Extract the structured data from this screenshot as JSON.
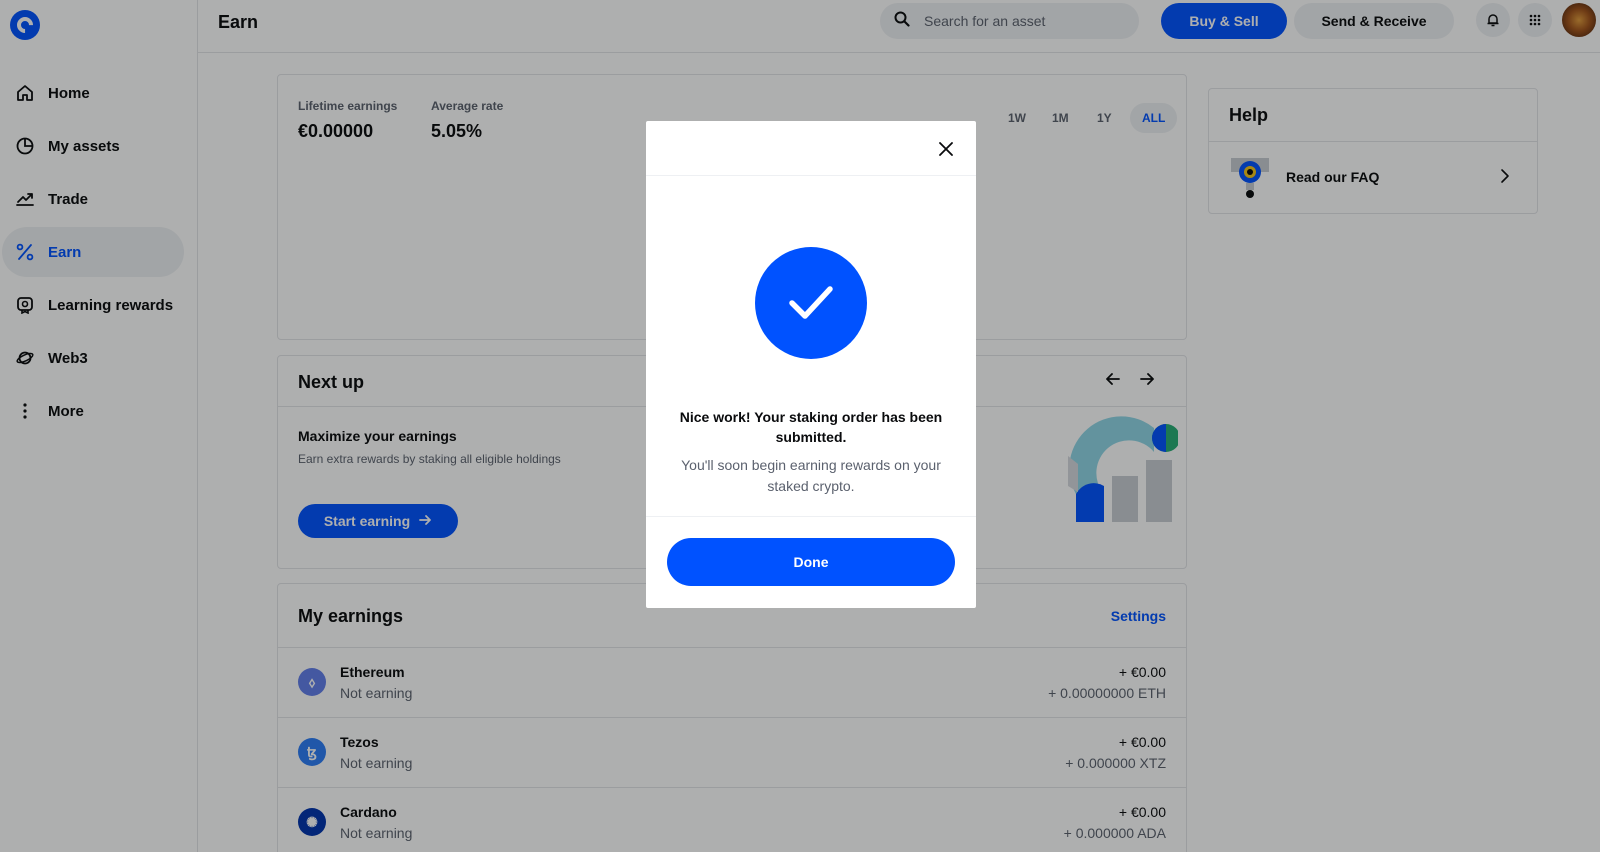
{
  "sidebar": {
    "items": [
      {
        "label": "Home",
        "icon": "home-icon"
      },
      {
        "label": "My assets",
        "icon": "pie-chart-icon"
      },
      {
        "label": "Trade",
        "icon": "trend-icon"
      },
      {
        "label": "Earn",
        "icon": "percent-icon",
        "active": true
      },
      {
        "label": "Learning rewards",
        "icon": "reward-icon"
      },
      {
        "label": "Web3",
        "icon": "planet-icon"
      },
      {
        "label": "More",
        "icon": "more-vertical-icon"
      }
    ]
  },
  "header": {
    "title": "Earn",
    "search_placeholder": "Search for an asset",
    "buy_sell_label": "Buy & Sell",
    "send_receive_label": "Send & Receive"
  },
  "summary": {
    "lifetime_label": "Lifetime earnings",
    "lifetime_value": "€0.00000",
    "rate_label": "Average rate",
    "rate_value": "5.05%",
    "ranges": [
      "1W",
      "1M",
      "1Y",
      "ALL"
    ],
    "selected_range": "ALL"
  },
  "next_up": {
    "title": "Next up",
    "heading": "Maximize your earnings",
    "description": "Earn extra rewards by staking all eligible holdings",
    "cta_label": "Start earning"
  },
  "my_earnings": {
    "title": "My earnings",
    "settings_label": "Settings",
    "rows": [
      {
        "name": "Ethereum",
        "status": "Not earning",
        "fiat": "+ €0.00",
        "crypto": "+ 0.00000000 ETH",
        "color": "#627eea",
        "symbol": "⬨"
      },
      {
        "name": "Tezos",
        "status": "Not earning",
        "fiat": "+ €0.00",
        "crypto": "+ 0.000000 XTZ",
        "color": "#2c7df7",
        "symbol": "ꜩ"
      },
      {
        "name": "Cardano",
        "status": "Not earning",
        "fiat": "+ €0.00",
        "crypto": "+ 0.000000 ADA",
        "color": "#0033ad",
        "symbol": "✺"
      }
    ]
  },
  "help": {
    "title": "Help",
    "faq_label": "Read our FAQ"
  },
  "modal": {
    "title": "Nice work! Your staking order has been submitted.",
    "subtitle": "You'll soon begin earning rewards on your staked crypto.",
    "done_label": "Done"
  },
  "colors": {
    "accent": "#0052ff",
    "muted_text": "#5b616e",
    "surface": "#eef0f3"
  }
}
